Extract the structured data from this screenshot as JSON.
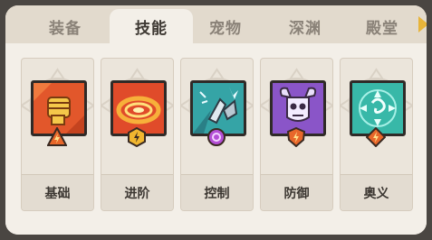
{
  "tabs": [
    {
      "label": "装备"
    },
    {
      "label": "技能"
    },
    {
      "label": "宠物"
    },
    {
      "label": "深渊"
    },
    {
      "label": "殿堂"
    }
  ],
  "active_tab": "技能",
  "skills": [
    {
      "label": "基础",
      "icon": "fist-icon",
      "badge": "lightning-triangle-badge",
      "color": "#e2572b"
    },
    {
      "label": "进阶",
      "icon": "fire-ring-icon",
      "badge": "lightning-hexagon-badge",
      "color": "#e04b2a"
    },
    {
      "label": "控制",
      "icon": "shatter-icon",
      "badge": "purple-orb-badge",
      "color": "#35a4a6"
    },
    {
      "label": "防御",
      "icon": "horned-skull-icon",
      "badge": "lightning-shield-badge",
      "color": "#8a55c8"
    },
    {
      "label": "奥义",
      "icon": "rune-sigil-icon",
      "badge": "lightning-diamond-badge",
      "color": "#38b8a8"
    }
  ],
  "colors": {
    "accent": "#e7b43a",
    "panel": "#f3efe8",
    "tab_bar": "#e2dacd"
  }
}
